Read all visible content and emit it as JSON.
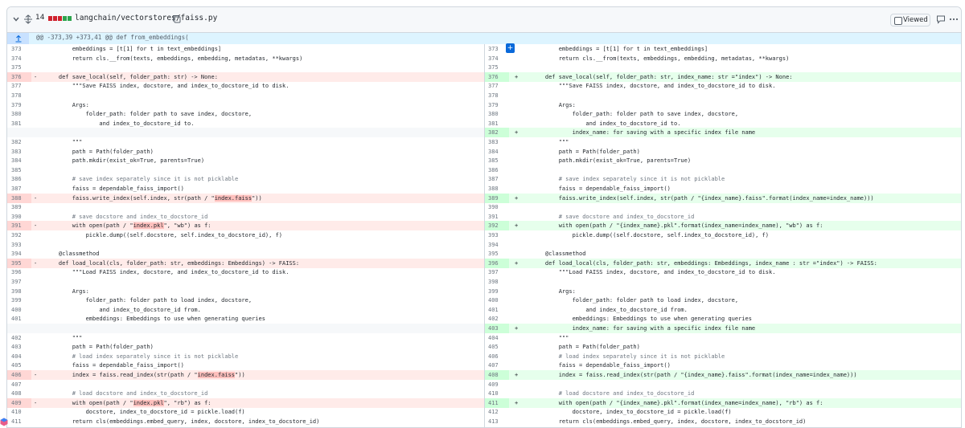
{
  "file_header": {
    "changed_count": "14",
    "path": "langchain/vectorstores/faiss.py",
    "viewed_label": "Viewed",
    "bar_colors": [
      "#cf222e",
      "#cf222e",
      "#cf222e",
      "#2da44e",
      "#2da44e"
    ]
  },
  "hunk_header": "@@ -373,39 +373,41 @@ def from_embeddings(",
  "colors": {
    "deleted_bg": "#ffebe9",
    "added_bg": "#e6ffec",
    "deleted_word": "#ffc0bd",
    "added_word": "#abf2bc",
    "accent": "#0969da"
  },
  "left_rows": [
    {
      "n": "373",
      "t": "ctx",
      "code": "        embeddings = [t[1] for t in text_embeddings]"
    },
    {
      "n": "374",
      "t": "ctx",
      "code": "        return cls.__from(texts, embeddings, embedding, metadatas, **kwargs)"
    },
    {
      "n": "375",
      "t": "ctx",
      "code": ""
    },
    {
      "n": "376",
      "t": "del",
      "code": "    def save_local(self, folder_path: str) -> None:"
    },
    {
      "n": "377",
      "t": "ctx",
      "code": "        \"\"\"Save FAISS index, docstore, and index_to_docstore_id to disk."
    },
    {
      "n": "378",
      "t": "ctx",
      "code": ""
    },
    {
      "n": "379",
      "t": "ctx",
      "code": "        Args:"
    },
    {
      "n": "380",
      "t": "ctx",
      "code": "            folder_path: folder path to save index, docstore,"
    },
    {
      "n": "381",
      "t": "ctx",
      "code": "                and index_to_docstore_id to."
    },
    {
      "n": "",
      "t": "empty",
      "code": ""
    },
    {
      "n": "382",
      "t": "ctx",
      "code": "        \"\"\""
    },
    {
      "n": "383",
      "t": "ctx",
      "code": "        path = Path(folder_path)"
    },
    {
      "n": "384",
      "t": "ctx",
      "code": "        path.mkdir(exist_ok=True, parents=True)"
    },
    {
      "n": "385",
      "t": "ctx",
      "code": ""
    },
    {
      "n": "386",
      "t": "ctx",
      "code": "        # save index separately since it is not picklable"
    },
    {
      "n": "387",
      "t": "ctx",
      "code": "        faiss = dependable_faiss_import()"
    },
    {
      "n": "388",
      "t": "del",
      "code": "        faiss.write_index(self.index, str(path / \"index.faiss\"))"
    },
    {
      "n": "389",
      "t": "ctx",
      "code": ""
    },
    {
      "n": "390",
      "t": "ctx",
      "code": "        # save docstore and index_to_docstore_id"
    },
    {
      "n": "391",
      "t": "del",
      "code": "        with open(path / \"index.pkl\", \"wb\") as f:"
    },
    {
      "n": "392",
      "t": "ctx",
      "code": "            pickle.dump((self.docstore, self.index_to_docstore_id), f)"
    },
    {
      "n": "393",
      "t": "ctx",
      "code": ""
    },
    {
      "n": "394",
      "t": "ctx",
      "code": "    @classmethod"
    },
    {
      "n": "395",
      "t": "del",
      "code": "    def load_local(cls, folder_path: str, embeddings: Embeddings) -> FAISS:"
    },
    {
      "n": "396",
      "t": "ctx",
      "code": "        \"\"\"Load FAISS index, docstore, and index_to_docstore_id to disk."
    },
    {
      "n": "397",
      "t": "ctx",
      "code": ""
    },
    {
      "n": "398",
      "t": "ctx",
      "code": "        Args:"
    },
    {
      "n": "399",
      "t": "ctx",
      "code": "            folder_path: folder path to load index, docstore,"
    },
    {
      "n": "400",
      "t": "ctx",
      "code": "                and index_to_docstore_id from."
    },
    {
      "n": "401",
      "t": "ctx",
      "code": "            embeddings: Embeddings to use when generating queries"
    },
    {
      "n": "",
      "t": "empty",
      "code": ""
    },
    {
      "n": "402",
      "t": "ctx",
      "code": "        \"\"\""
    },
    {
      "n": "403",
      "t": "ctx",
      "code": "        path = Path(folder_path)"
    },
    {
      "n": "404",
      "t": "ctx",
      "code": "        # load index separately since it is not picklable"
    },
    {
      "n": "405",
      "t": "ctx",
      "code": "        faiss = dependable_faiss_import()"
    },
    {
      "n": "406",
      "t": "del",
      "code": "        index = faiss.read_index(str(path / \"index.faiss\"))"
    },
    {
      "n": "407",
      "t": "ctx",
      "code": ""
    },
    {
      "n": "408",
      "t": "ctx",
      "code": "        # load docstore and index_to_docstore_id"
    },
    {
      "n": "409",
      "t": "del",
      "code": "        with open(path / \"index.pkl\", \"rb\") as f:"
    },
    {
      "n": "410",
      "t": "ctx",
      "code": "            docstore, index_to_docstore_id = pickle.load(f)"
    },
    {
      "n": "411",
      "t": "ctx",
      "code": "        return cls(embeddings.embed_query, index, docstore, index_to_docstore_id)"
    }
  ],
  "right_rows": [
    {
      "n": "373",
      "t": "ctx",
      "code": "        embeddings = [t[1] for t in text_embeddings]"
    },
    {
      "n": "374",
      "t": "ctx",
      "code": "        return cls.__from(texts, embeddings, embedding, metadatas, **kwargs)"
    },
    {
      "n": "375",
      "t": "ctx",
      "code": ""
    },
    {
      "n": "376",
      "t": "add",
      "code": "    def save_local(self, folder_path: str, index_name: str =\"index\") -> None:"
    },
    {
      "n": "377",
      "t": "ctx",
      "code": "        \"\"\"Save FAISS index, docstore, and index_to_docstore_id to disk."
    },
    {
      "n": "378",
      "t": "ctx",
      "code": ""
    },
    {
      "n": "379",
      "t": "ctx",
      "code": "        Args:"
    },
    {
      "n": "380",
      "t": "ctx",
      "code": "            folder_path: folder path to save index, docstore,"
    },
    {
      "n": "381",
      "t": "ctx",
      "code": "                and index_to_docstore_id to."
    },
    {
      "n": "382",
      "t": "add",
      "code": "            index_name: for saving with a specific index file name"
    },
    {
      "n": "383",
      "t": "ctx",
      "code": "        \"\"\""
    },
    {
      "n": "384",
      "t": "ctx",
      "code": "        path = Path(folder_path)"
    },
    {
      "n": "385",
      "t": "ctx",
      "code": "        path.mkdir(exist_ok=True, parents=True)"
    },
    {
      "n": "386",
      "t": "ctx",
      "code": ""
    },
    {
      "n": "387",
      "t": "ctx",
      "code": "        # save index separately since it is not picklable"
    },
    {
      "n": "388",
      "t": "ctx",
      "code": "        faiss = dependable_faiss_import()"
    },
    {
      "n": "389",
      "t": "add",
      "code": "        faiss.write_index(self.index, str(path / \"{index_name}.faiss\".format(index_name=index_name)))"
    },
    {
      "n": "390",
      "t": "ctx",
      "code": ""
    },
    {
      "n": "391",
      "t": "ctx",
      "code": "        # save docstore and index_to_docstore_id"
    },
    {
      "n": "392",
      "t": "add",
      "code": "        with open(path / \"{index_name}.pkl\".format(index_name=index_name), \"wb\") as f:"
    },
    {
      "n": "393",
      "t": "ctx",
      "code": "            pickle.dump((self.docstore, self.index_to_docstore_id), f)"
    },
    {
      "n": "394",
      "t": "ctx",
      "code": ""
    },
    {
      "n": "395",
      "t": "ctx",
      "code": "    @classmethod"
    },
    {
      "n": "396",
      "t": "add",
      "code": "    def load_local(cls, folder_path: str, embeddings: Embeddings, index_name : str =\"index\") -> FAISS:"
    },
    {
      "n": "397",
      "t": "ctx",
      "code": "        \"\"\"Load FAISS index, docstore, and index_to_docstore_id to disk."
    },
    {
      "n": "398",
      "t": "ctx",
      "code": ""
    },
    {
      "n": "399",
      "t": "ctx",
      "code": "        Args:"
    },
    {
      "n": "400",
      "t": "ctx",
      "code": "            folder_path: folder path to load index, docstore,"
    },
    {
      "n": "401",
      "t": "ctx",
      "code": "                and index_to_docstore_id from."
    },
    {
      "n": "402",
      "t": "ctx",
      "code": "            embeddings: Embeddings to use when generating queries"
    },
    {
      "n": "403",
      "t": "add",
      "code": "            index_name: for saving with a specific index file name"
    },
    {
      "n": "404",
      "t": "ctx",
      "code": "        \"\"\""
    },
    {
      "n": "405",
      "t": "ctx",
      "code": "        path = Path(folder_path)"
    },
    {
      "n": "406",
      "t": "ctx",
      "code": "        # load index separately since it is not picklable"
    },
    {
      "n": "407",
      "t": "ctx",
      "code": "        faiss = dependable_faiss_import()"
    },
    {
      "n": "408",
      "t": "add",
      "code": "        index = faiss.read_index(str(path / \"{index_name}.faiss\".format(index_name=index_name)))"
    },
    {
      "n": "409",
      "t": "ctx",
      "code": ""
    },
    {
      "n": "410",
      "t": "ctx",
      "code": "        # load docstore and index_to_docstore_id"
    },
    {
      "n": "411",
      "t": "add",
      "code": "        with open(path / \"{index_name}.pkl\".format(index_name=index_name), \"rb\") as f:"
    },
    {
      "n": "412",
      "t": "ctx",
      "code": "            docstore, index_to_docstore_id = pickle.load(f)"
    },
    {
      "n": "413",
      "t": "ctx",
      "code": "        return cls(embeddings.embed_query, index, docstore, index_to_docstore_id)"
    }
  ]
}
